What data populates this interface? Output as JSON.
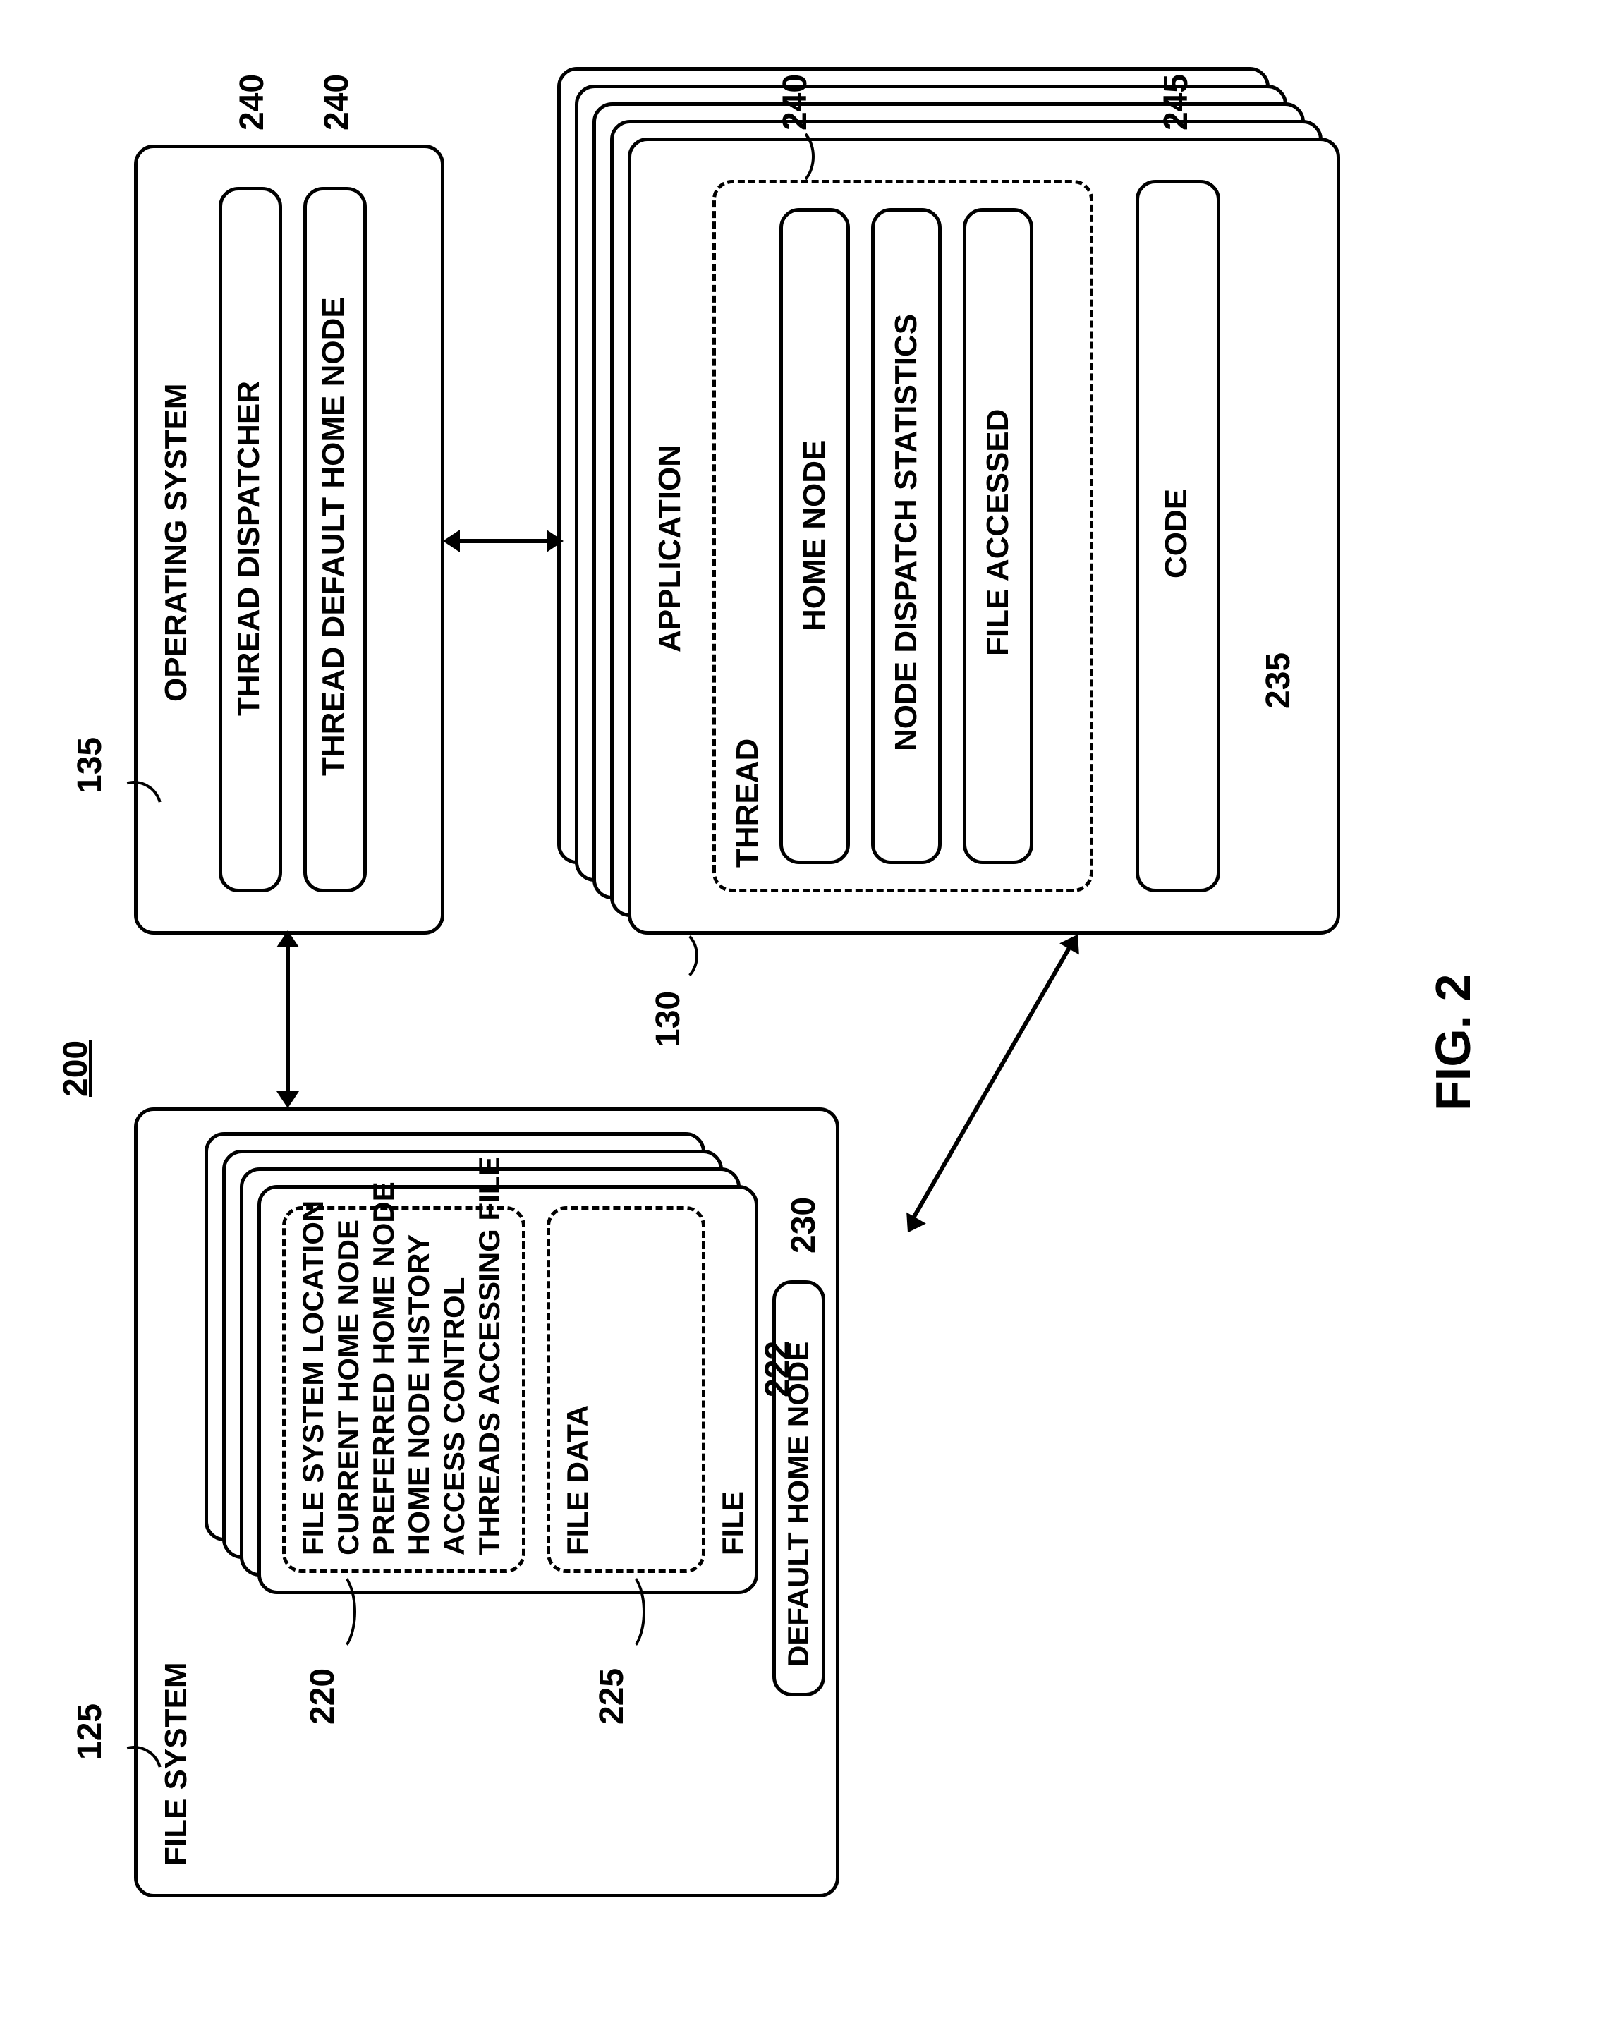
{
  "figure": {
    "caption": "FIG. 2",
    "ref200": "200"
  },
  "refs": {
    "r125": "125",
    "r135": "135",
    "r130": "130",
    "r220": "220",
    "r225": "225",
    "r222": "222",
    "r230": "230",
    "r235": "235",
    "r240_top1": "240",
    "r240_top2": "240",
    "r240_thread": "240",
    "r245": "245"
  },
  "os": {
    "title": "OPERATING SYSTEM",
    "thread_dispatcher": "THREAD DISPATCHER",
    "thread_default_home_node": "THREAD DEFAULT HOME NODE"
  },
  "fs": {
    "title": "FILE SYSTEM",
    "fileblock": {
      "l1": "FILE SYSTEM LOCATION",
      "l2": "CURRENT HOME NODE",
      "l3": "PREFERRED HOME NODE",
      "l4": "HOME NODE HISTORY",
      "l5": "ACCESS CONTROL",
      "l6": "THREADS ACCESSING FILE"
    },
    "filedata": "FILE DATA",
    "file": "FILE",
    "default_home_node": "DEFAULT HOME NODE"
  },
  "app": {
    "title": "APPLICATION",
    "thread": "THREAD",
    "home_node": "HOME NODE",
    "node_dispatch_stats": "NODE DISPATCH STATISTICS",
    "file_accessed": "FILE ACCESSED",
    "code": "CODE"
  }
}
